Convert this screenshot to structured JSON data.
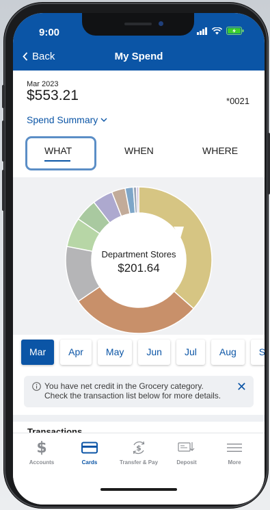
{
  "status_bar": {
    "time": "9:00",
    "icons": [
      "signal-icon",
      "wifi-icon",
      "battery-charging-icon"
    ]
  },
  "nav": {
    "back_label": "Back",
    "title": "My Spend"
  },
  "summary": {
    "month": "Mar 2023",
    "amount": "$553.21",
    "card": "*0021",
    "view_label": "Spend Summary"
  },
  "tabs": [
    {
      "label": "WHAT",
      "selected": true
    },
    {
      "label": "WHEN",
      "selected": false
    },
    {
      "label": "WHERE",
      "selected": false
    }
  ],
  "chart_data": {
    "type": "pie",
    "donut": true,
    "selected_category": "Department Stores",
    "selected_value": "$201.64",
    "slices": [
      {
        "value": 36.5,
        "color": "#d6c583"
      },
      {
        "value": 29.0,
        "color": "#c8906a"
      },
      {
        "value": 12.5,
        "color": "#b5b5b7"
      },
      {
        "value": 6.5,
        "color": "#b7d6a6"
      },
      {
        "value": 5.0,
        "color": "#a9c9a0"
      },
      {
        "value": 4.5,
        "color": "#ada9cf"
      },
      {
        "value": 3.0,
        "color": "#c2ab99"
      },
      {
        "value": 1.8,
        "color": "#7ea6c8"
      },
      {
        "value": 0.7,
        "color": "#9da8b8"
      },
      {
        "value": 0.5,
        "color": "#cdbedd"
      }
    ]
  },
  "months": [
    {
      "label": "Mar",
      "active": true
    },
    {
      "label": "Apr",
      "active": false
    },
    {
      "label": "May",
      "active": false
    },
    {
      "label": "Jun",
      "active": false
    },
    {
      "label": "Jul",
      "active": false
    },
    {
      "label": "Aug",
      "active": false
    },
    {
      "label": "Se",
      "active": false
    }
  ],
  "notice": {
    "text": "You have net credit in the Grocery category. Check the transaction list below for more details."
  },
  "section": {
    "transactions": "Transactions"
  },
  "tabbar": [
    {
      "label": "Accounts",
      "icon": "dollar-icon",
      "active": false
    },
    {
      "label": "Cards",
      "icon": "card-icon",
      "active": true
    },
    {
      "label": "Transfer & Pay",
      "icon": "transfer-icon",
      "active": false
    },
    {
      "label": "Deposit",
      "icon": "deposit-icon",
      "active": false
    },
    {
      "label": "More",
      "icon": "menu-icon",
      "active": false
    }
  ],
  "colors": {
    "brand_blue": "#0b55a6",
    "background_gray": "#f0f1f3"
  }
}
